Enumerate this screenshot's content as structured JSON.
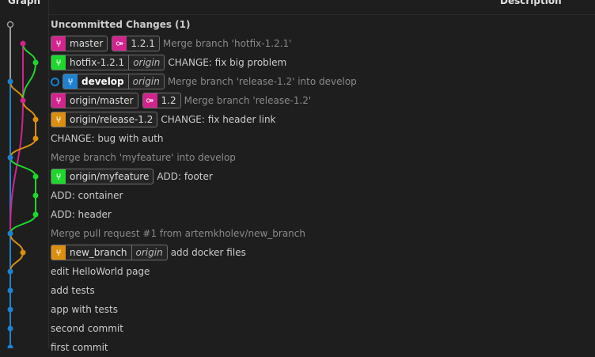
{
  "header": {
    "graph": "Graph",
    "description": "Description"
  },
  "colors": {
    "blue": "#1f82d1",
    "magenta": "#d1248d",
    "green": "#1ed62d",
    "orange": "#db8f10",
    "grey": "#9a9a9a"
  },
  "rows": [
    {
      "message": "Uncommitted Changes (1)",
      "style": "bold",
      "refs": []
    },
    {
      "message": "Merge branch 'hotfix-1.2.1'",
      "style": "muted",
      "refs": [
        {
          "kind": "branch",
          "name": "master",
          "color": "#d1248d"
        },
        {
          "kind": "tag",
          "name": "1.2.1",
          "color": "#d1248d"
        }
      ]
    },
    {
      "message": "CHANGE: fix big problem",
      "style": "normal",
      "refs": [
        {
          "kind": "branch",
          "name": "hotfix-1.2.1",
          "remote": "origin",
          "color": "#1ed62d"
        }
      ]
    },
    {
      "message": "Merge branch 'release-1.2' into develop",
      "style": "muted",
      "head": true,
      "refs": [
        {
          "kind": "branch",
          "name": "develop",
          "remote": "origin",
          "color": "#1f82d1",
          "bold": true
        }
      ]
    },
    {
      "message": "Merge branch 'release-1.2'",
      "style": "muted",
      "refs": [
        {
          "kind": "branch",
          "name": "origin/master",
          "color": "#d1248d"
        },
        {
          "kind": "tag",
          "name": "1.2",
          "color": "#d1248d"
        }
      ]
    },
    {
      "message": "CHANGE: fix header link",
      "style": "normal",
      "refs": [
        {
          "kind": "branch",
          "name": "origin/release-1.2",
          "color": "#db8f10"
        }
      ]
    },
    {
      "message": "CHANGE: bug with auth",
      "style": "normal",
      "refs": []
    },
    {
      "message": "Merge branch 'myfeature' into develop",
      "style": "muted",
      "refs": []
    },
    {
      "message": "ADD: footer",
      "style": "normal",
      "refs": [
        {
          "kind": "branch",
          "name": "origin/myfeature",
          "color": "#1ed62d"
        }
      ]
    },
    {
      "message": "ADD: container",
      "style": "normal",
      "refs": []
    },
    {
      "message": "ADD: header",
      "style": "normal",
      "refs": []
    },
    {
      "message": "Merge pull request #1 from artemkholev/new_branch",
      "style": "muted",
      "refs": []
    },
    {
      "message": "add docker files",
      "style": "normal",
      "refs": [
        {
          "kind": "branch",
          "name": "new_branch",
          "remote": "origin",
          "color": "#db8f10"
        }
      ]
    },
    {
      "message": "edit HelloWorld page",
      "style": "normal",
      "refs": []
    },
    {
      "message": "add tests",
      "style": "normal",
      "refs": []
    },
    {
      "message": "app with tests",
      "style": "normal",
      "refs": []
    },
    {
      "message": "second commit",
      "style": "normal",
      "refs": []
    },
    {
      "message": "first commit",
      "style": "normal",
      "refs": []
    }
  ]
}
